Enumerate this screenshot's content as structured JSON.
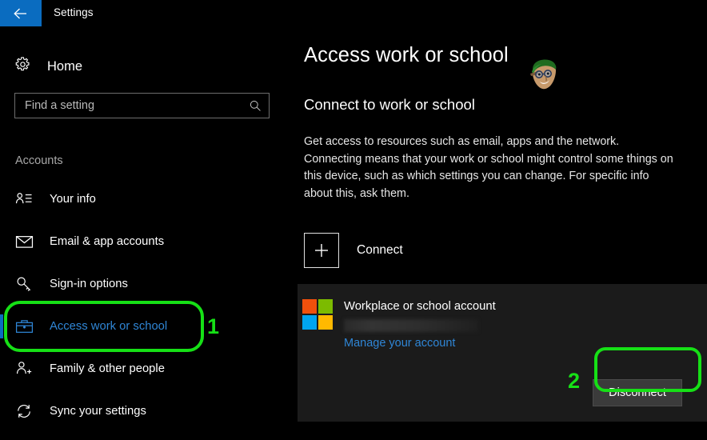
{
  "window": {
    "title": "Settings",
    "back_icon": "back-arrow-icon"
  },
  "sidebar": {
    "home": {
      "label": "Home",
      "icon": "gear-icon"
    },
    "search": {
      "placeholder": "Find a setting",
      "value": "",
      "icon": "search-icon"
    },
    "section_title": "Accounts",
    "items": [
      {
        "label": "Your info",
        "icon": "person-details-icon",
        "selected": false
      },
      {
        "label": "Email & app accounts",
        "icon": "envelope-icon",
        "selected": false
      },
      {
        "label": "Sign-in options",
        "icon": "key-icon",
        "selected": false
      },
      {
        "label": "Access work or school",
        "icon": "briefcase-icon",
        "selected": true
      },
      {
        "label": "Family & other people",
        "icon": "person-add-icon",
        "selected": false
      },
      {
        "label": "Sync your settings",
        "icon": "sync-arrows-icon",
        "selected": false
      }
    ]
  },
  "main": {
    "page_title": "Access work or school",
    "watermark_icon": "cartoon-avatar-watermark",
    "subheading": "Connect to work or school",
    "description": "Get access to resources such as email, apps and the network. Connecting means that your work or school might control some things on this device, such as which settings you can change. For specific info about this, ask them.",
    "connect": {
      "label": "Connect",
      "icon": "plus-icon"
    },
    "account_card": {
      "logo_icon": "microsoft-logo-icon",
      "name": "Workplace or school account",
      "email_redacted": "",
      "manage_link": "Manage your account",
      "disconnect_label": "Disconnect"
    }
  },
  "annotations": [
    {
      "number": "1",
      "target": "sidebar-item-access-work-or-school"
    },
    {
      "number": "2",
      "target": "disconnect-button"
    }
  ],
  "colors": {
    "accent_blue": "#0a6cc0",
    "link_blue": "#2f86d6",
    "annotation_green": "#16e016",
    "card_background": "#1b1b1b",
    "page_background": "#000000",
    "ms_red": "#f0500c",
    "ms_green": "#7cbb00",
    "ms_blue": "#00a4ef",
    "ms_yellow": "#ffb900"
  }
}
